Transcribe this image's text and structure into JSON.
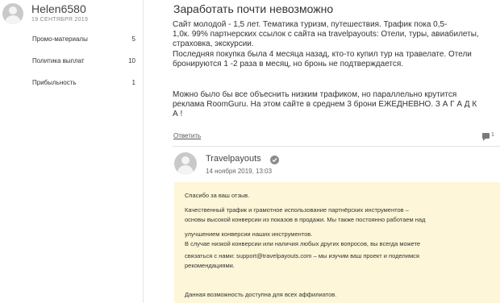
{
  "user": {
    "name": "Helen6580",
    "date": "19 СЕНТЯБРЯ 2019",
    "stats": [
      {
        "label": "Промо-материалы",
        "value": "5"
      },
      {
        "label": "Политика выплат",
        "value": "10"
      },
      {
        "label": "Прибыльность",
        "value": "1"
      }
    ]
  },
  "post": {
    "title": "Заработать почти невозможно",
    "paragraph1": "Сайт молодой - 1,5 лет. Тематика туризм, путешествия. Трафик  пока 0,5-\n1,0к. 99% партнерских ссылок с сайта на travelpayouts: Отели, туры, авиабилеты,\nстраховка, экскурсии.\nПоследняя покупка была 4 месяца назад, кто-то купил тур на травелате. Отели\nбронируются 1 -2 раза в месяц, но бронь не подтверждается.",
    "paragraph2": "Можно было бы все объеснить низким трафиком, но параллельно крутится\nреклама RoomGuru. На этом сайте в среднем 3 брони ЕЖЕДНЕВНО.  З А Г А Д К\nА !",
    "reply_label": "Ответить",
    "comment_count": "1"
  },
  "reply": {
    "author": "Travelpayouts",
    "date": "14 ноября 2019, 13:03",
    "lines": [
      "Спасибо за ваш отзыв.",
      "Качественный трафик и грамотное использование партнёрских инструментов –",
      "основы высокой конверсии из показов в продажи. Мы также постоянно работаем над",
      "улучшением конверсии наших инструментов.",
      "В случае низкой конверсии или наличия любых других вопросов, вы всегда можете",
      "связаться с нами: support@travelpayouts.com – мы изучим ваш проект и поделимся",
      "рекомендациями.",
      "Данная возможность доступна для всех аффилиатов."
    ]
  }
}
